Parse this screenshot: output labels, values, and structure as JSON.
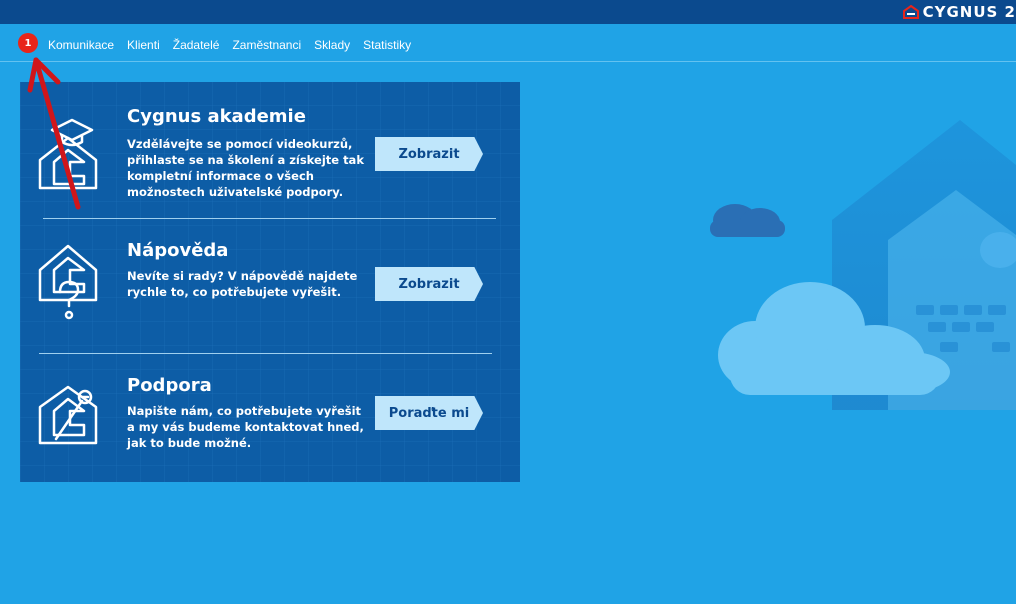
{
  "brand": {
    "name": "CYGNUS 2"
  },
  "annotation": {
    "badge": "1"
  },
  "nav": {
    "items": [
      "Komunikace",
      "Klienti",
      "Žadatelé",
      "Zaměstnanci",
      "Sklady",
      "Statistiky"
    ]
  },
  "sections": {
    "akademie": {
      "title": "Cygnus akademie",
      "description": "Vzdělávejte se pomocí videokurzů, přihlaste se na školení a získejte tak kompletní informace o všech možnostech uživatelské podpory.",
      "button": "Zobrazit"
    },
    "napoveda": {
      "title": "Nápověda",
      "description": "Nevíte si rady? V nápovědě najdete rychle to, co potřebujete vyřešit.",
      "button": "Zobrazit"
    },
    "podpora": {
      "title": "Podpora",
      "description": "Napište nám, co potřebujete vyřešit a my vás budeme kontaktovat hned, jak to bude možné.",
      "button": "Poraďte mi"
    }
  },
  "colors": {
    "background": "#20a3e6",
    "topbar": "#0b4a8e",
    "panel": "#0d5da6",
    "button": "#bfe6fb",
    "badge": "#e8251a",
    "arrow": "#d0161a"
  }
}
